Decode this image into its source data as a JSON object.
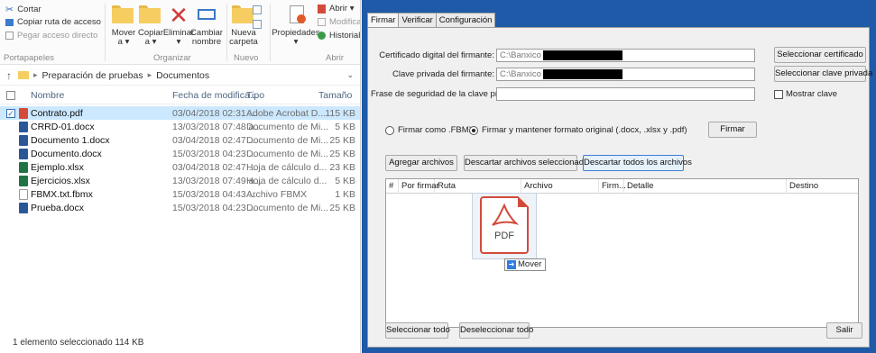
{
  "explorer": {
    "ribbon": {
      "cortar": "Cortar",
      "copiar_ruta": "Copiar ruta de acceso",
      "pegar_acceso": "Pegar acceso directo",
      "portapapeles": "Portapapeles",
      "mover": "Mover\na ▾",
      "copiar": "Copiar\na ▾",
      "eliminar": "Eliminar\n▾",
      "cambiar_nombre": "Cambiar\nnombre",
      "organizar": "Organizar",
      "nueva_carpeta": "Nueva\ncarpeta",
      "nuevo": "Nuevo",
      "propiedades": "Propiedades\n▾",
      "abrir": "Abrir ▾",
      "modificar": "Modificar",
      "historial": "Historial",
      "abrir_group": "Abrir"
    },
    "breadcrumb": [
      "Preparación de pruebas",
      "Documentos"
    ],
    "columns": {
      "nombre": "Nombre",
      "fecha": "Fecha de modifica...",
      "tipo": "Tipo",
      "tamano": "Tamaño"
    },
    "files": [
      {
        "name": "Contrato.pdf",
        "date": "03/04/2018 02:31 ...",
        "type": "Adobe Acrobat D...",
        "size": "115 KB",
        "selected": true,
        "kind": "pdf"
      },
      {
        "name": "CRRD-01.docx",
        "date": "13/03/2018 07:48 a...",
        "type": "Documento de Mi...",
        "size": "5 KB",
        "selected": false,
        "kind": "doc"
      },
      {
        "name": "Documento 1.docx",
        "date": "03/04/2018 02:47 ...",
        "type": "Documento de Mi...",
        "size": "25 KB",
        "selected": false,
        "kind": "doc"
      },
      {
        "name": "Documento.docx",
        "date": "15/03/2018 04:23 ...",
        "type": "Documento de Mi...",
        "size": "25 KB",
        "selected": false,
        "kind": "doc"
      },
      {
        "name": "Ejemplo.xlsx",
        "date": "03/04/2018 02:47 ...",
        "type": "Hoja de cálculo d...",
        "size": "23 KB",
        "selected": false,
        "kind": "xls"
      },
      {
        "name": "Ejercicios.xlsx",
        "date": "13/03/2018 07:49 a...",
        "type": "Hoja de cálculo d...",
        "size": "5 KB",
        "selected": false,
        "kind": "xls"
      },
      {
        "name": "FBMX.txt.fbmx",
        "date": "15/03/2018 04:43 ...",
        "type": "Archivo FBMX",
        "size": "1 KB",
        "selected": false,
        "kind": "blank"
      },
      {
        "name": "Prueba.docx",
        "date": "15/03/2018 04:23 ...",
        "type": "Documento de Mi...",
        "size": "25 KB",
        "selected": false,
        "kind": "doc"
      }
    ],
    "status": "1 elemento seleccionado  114 KB"
  },
  "signer": {
    "tabs": [
      "Firmar",
      "Verificar",
      "Configuración"
    ],
    "certificado_label": "Certificado digital del firmante:",
    "certificado_value": "C:\\Banxico",
    "clave_label": "Clave privada del firmante:",
    "clave_value": "C:\\Banxico",
    "frase_label": "Frase de seguridad de la clave privada:",
    "btn_seleccionar_certificado": "Seleccionar certificado",
    "btn_seleccionar_clave": "Seleccionar clave privada",
    "mostrar_clave": "Mostrar clave",
    "radio_fbmx": "Firmar como .FBMX",
    "radio_original": "Firmar y mantener formato original (.docx, .xlsx y .pdf)",
    "btn_firmar": "Firmar",
    "btn_agregar": "Agregar archivos",
    "btn_descartar_sel": "Descartar archivos seleccionados",
    "btn_descartar_todos": "Descartar todos los archivos",
    "table_headers": [
      "#",
      "Por firmar",
      "Ruta",
      "Archivo",
      "Firm...",
      "Detalle",
      "Destino"
    ],
    "btn_seleccionar_todo": "Seleccionar todo",
    "btn_deseleccionar_todo": "Deseleccionar todo",
    "btn_salir": "Salir"
  },
  "drag": {
    "pdf_label": "PDF",
    "tooltip": "Mover"
  },
  "colors": {
    "app_frame": "#1e5aa8",
    "selection": "#cce8ff",
    "pdf_red": "#d34a3b",
    "word_blue": "#2b5797",
    "excel_green": "#217346"
  }
}
